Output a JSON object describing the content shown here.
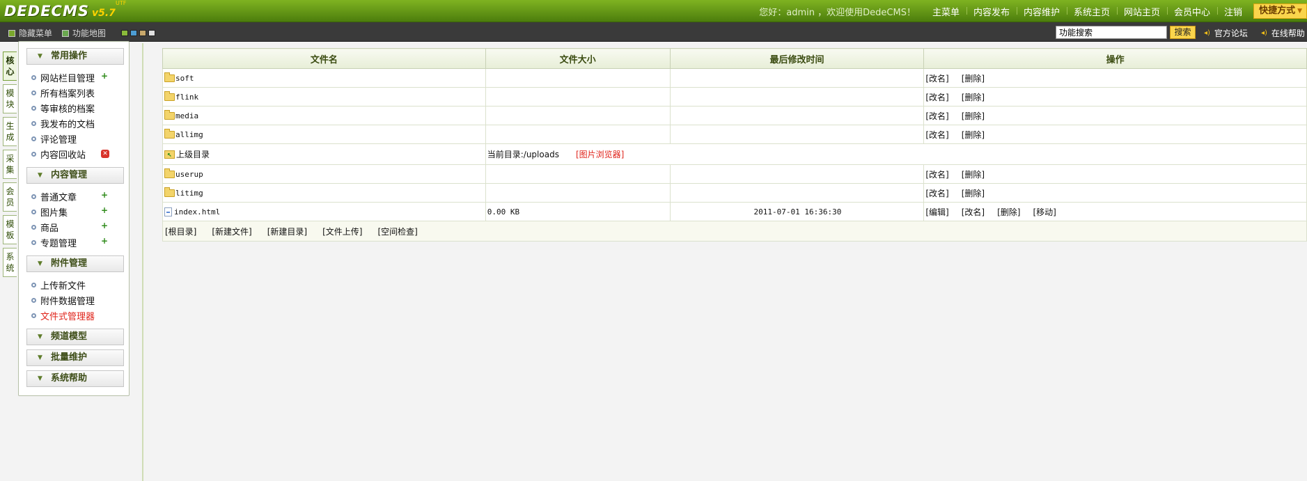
{
  "header": {
    "logo_main": "DEDECMS",
    "logo_version": "v5.7",
    "logo_sup": "UTF",
    "welcome": "您好：admin ，欢迎使用DedeCMS！",
    "nav": [
      "主菜单",
      "内容发布",
      "内容维护",
      "系统主页",
      "网站主页",
      "会员中心",
      "注销"
    ],
    "quick_button": "快捷方式"
  },
  "subbar": {
    "hide_menu": "隐藏菜单",
    "func_map": "功能地图",
    "search_value": "功能搜索",
    "search_button": "搜索",
    "links": [
      "官方论坛",
      "在线帮助"
    ],
    "swatch_colors": [
      "#8bbb3b",
      "#4d9dd3",
      "#c8a86b",
      "#e0e0e0"
    ]
  },
  "vtabs": [
    "核心",
    "模块",
    "生成",
    "采集",
    "会员",
    "模板",
    "系统"
  ],
  "sidebar": {
    "groups": [
      {
        "title": "常用操作",
        "items": [
          "网站栏目管理",
          "所有档案列表",
          "等审核的档案",
          "我发布的文档",
          "评论管理",
          "内容回收站"
        ]
      },
      {
        "title": "内容管理",
        "items": [
          "普通文章",
          "图片集",
          "商品",
          "专题管理"
        ]
      },
      {
        "title": "附件管理",
        "items": [
          "上传新文件",
          "附件数据管理",
          "文件式管理器"
        ]
      },
      {
        "title": "频道模型",
        "items": []
      },
      {
        "title": "批量维护",
        "items": []
      },
      {
        "title": "系统帮助",
        "items": []
      }
    ]
  },
  "table": {
    "headers": [
      "文件名",
      "文件大小",
      "最后修改时间",
      "操作"
    ],
    "rows": [
      {
        "name": "soft",
        "size": "",
        "time": "",
        "ops": [
          "[改名]",
          "[删除]"
        ]
      },
      {
        "name": "flink",
        "size": "",
        "time": "",
        "ops": [
          "[改名]",
          "[删除]"
        ]
      },
      {
        "name": "media",
        "size": "",
        "time": "",
        "ops": [
          "[改名]",
          "[删除]"
        ]
      },
      {
        "name": "allimg",
        "size": "",
        "time": "",
        "ops": [
          "[改名]",
          "[删除]"
        ]
      },
      {
        "name": "userup",
        "size": "",
        "time": "",
        "ops": [
          "[改名]",
          "[删除]"
        ]
      },
      {
        "name": "litimg",
        "size": "",
        "time": "",
        "ops": [
          "[改名]",
          "[删除]"
        ]
      },
      {
        "name": "index.html",
        "size": "0.00 KB",
        "time": "2011-07-01 16:36:30",
        "ops": [
          "[编辑]",
          "[改名]",
          "[删除]",
          "[移动]"
        ]
      }
    ],
    "parent_label": "上级目录",
    "current_dir_label": "当前目录:",
    "current_dir": "/uploads",
    "image_browser": "[图片浏览器]",
    "footer_links": [
      "[根目录]",
      "[新建文件]",
      "[新建目录]",
      "[文件上传]",
      "[空间检查]"
    ]
  }
}
